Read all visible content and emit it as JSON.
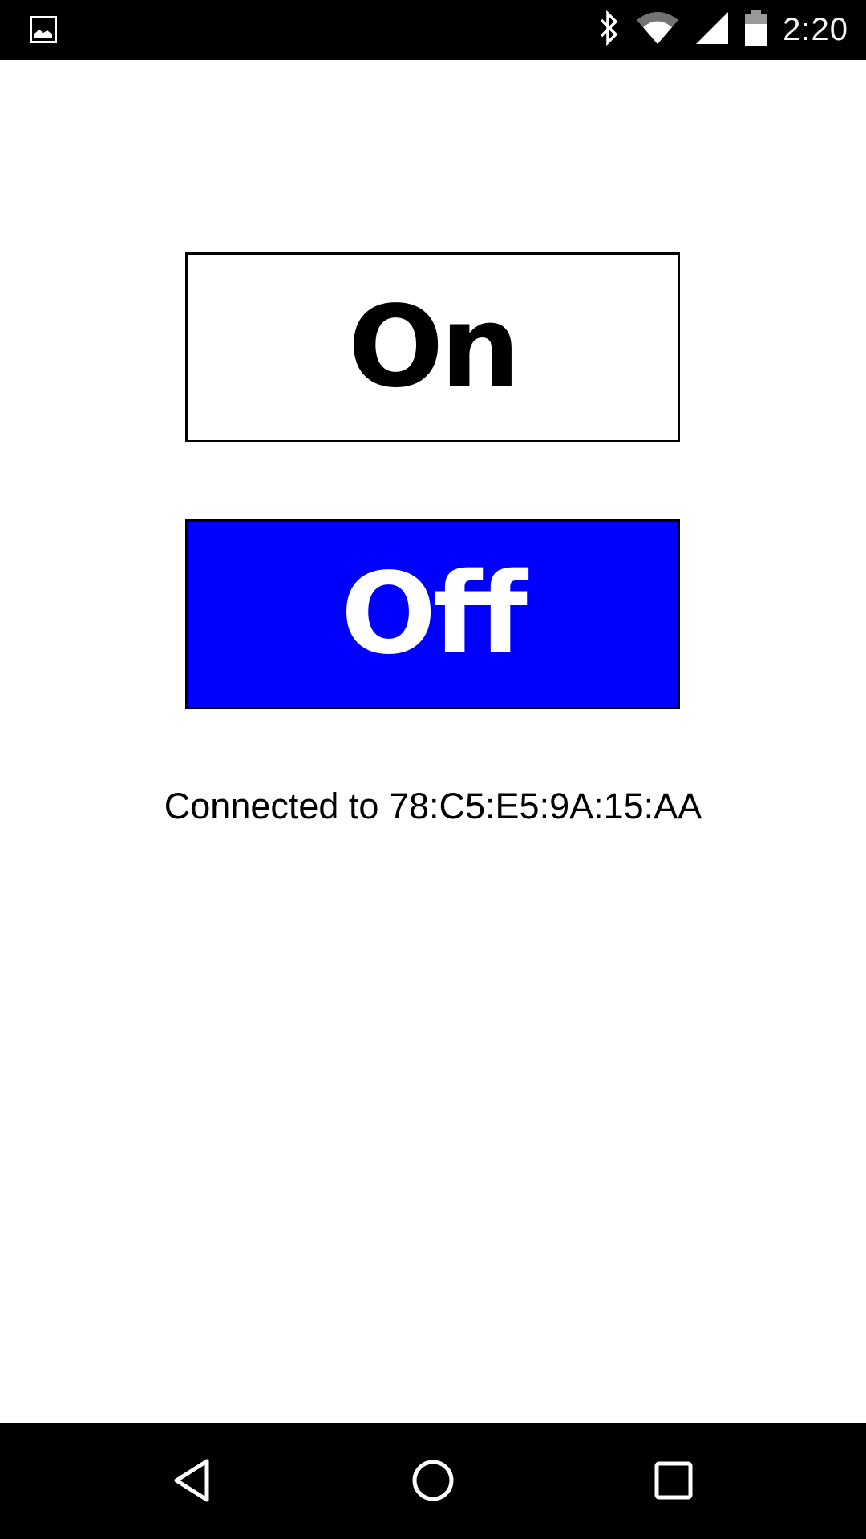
{
  "status_bar": {
    "notification_icon": "image-icon",
    "icons": [
      "bluetooth-icon",
      "wifi-icon",
      "cell-signal-icon",
      "battery-icon"
    ],
    "clock": "2:20"
  },
  "buttons": {
    "on_label": "On",
    "off_label": "Off",
    "off_color": "#0000ff"
  },
  "connection_status": "Connected to 78:C5:E5:9A:15:AA",
  "nav_bar": {
    "icons": [
      "back-icon",
      "home-icon",
      "recents-icon"
    ]
  }
}
